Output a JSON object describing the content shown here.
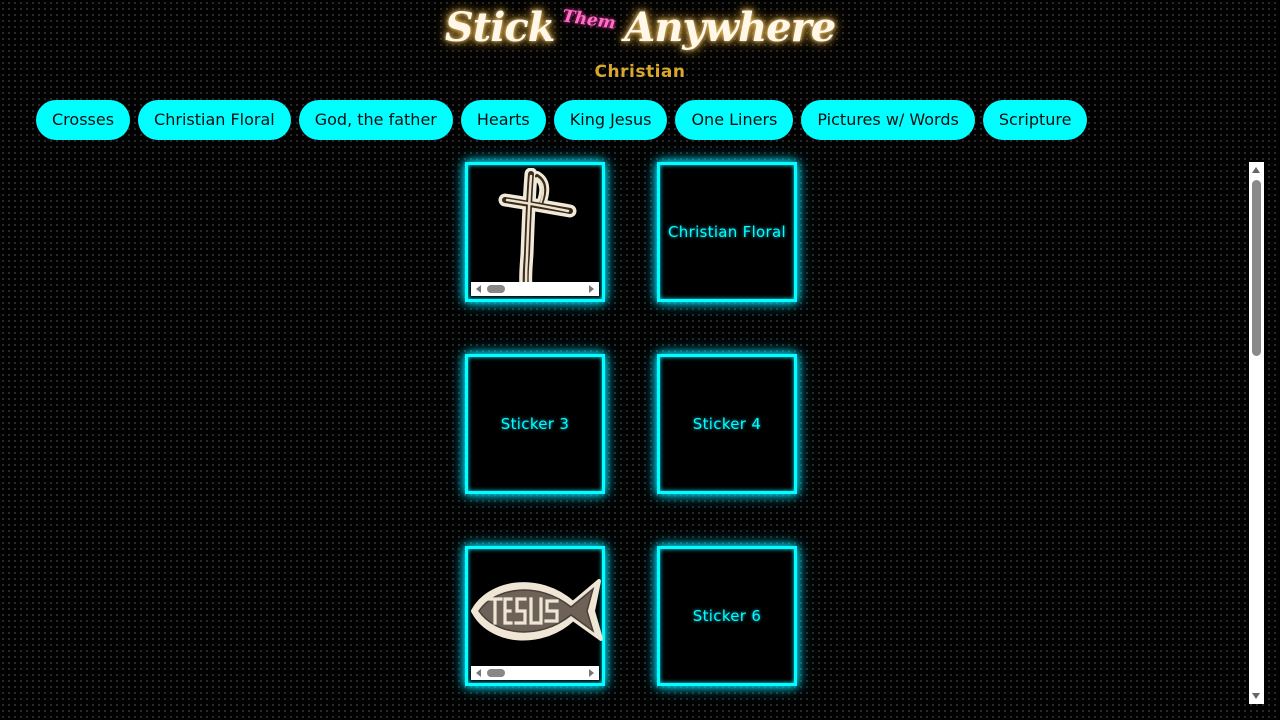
{
  "header": {
    "logo_word1": "Stick",
    "logo_them": "Them",
    "logo_word2": "Anywhere",
    "subtitle": "Christian"
  },
  "nav": [
    {
      "label": "Crosses"
    },
    {
      "label": "Christian Floral"
    },
    {
      "label": "God, the father"
    },
    {
      "label": "Hearts"
    },
    {
      "label": "King Jesus"
    },
    {
      "label": "One Liners"
    },
    {
      "label": "Pictures w/ Words"
    },
    {
      "label": "Scripture"
    }
  ],
  "stickers": [
    {
      "label": "",
      "image": "cross-sticker",
      "has_scrollbar": true
    },
    {
      "label": "Christian Floral",
      "image": "",
      "has_scrollbar": false
    },
    {
      "label": "Sticker 3",
      "image": "",
      "has_scrollbar": false
    },
    {
      "label": "Sticker 4",
      "image": "",
      "has_scrollbar": false
    },
    {
      "label": "",
      "image": "jesus-fish-sticker",
      "has_scrollbar": true
    },
    {
      "label": "Sticker 6",
      "image": "",
      "has_scrollbar": false
    }
  ],
  "colors": {
    "accent": "#00ffff",
    "subtitle": "#d9a82a",
    "them": "#ff6ec7",
    "background": "#000000"
  }
}
